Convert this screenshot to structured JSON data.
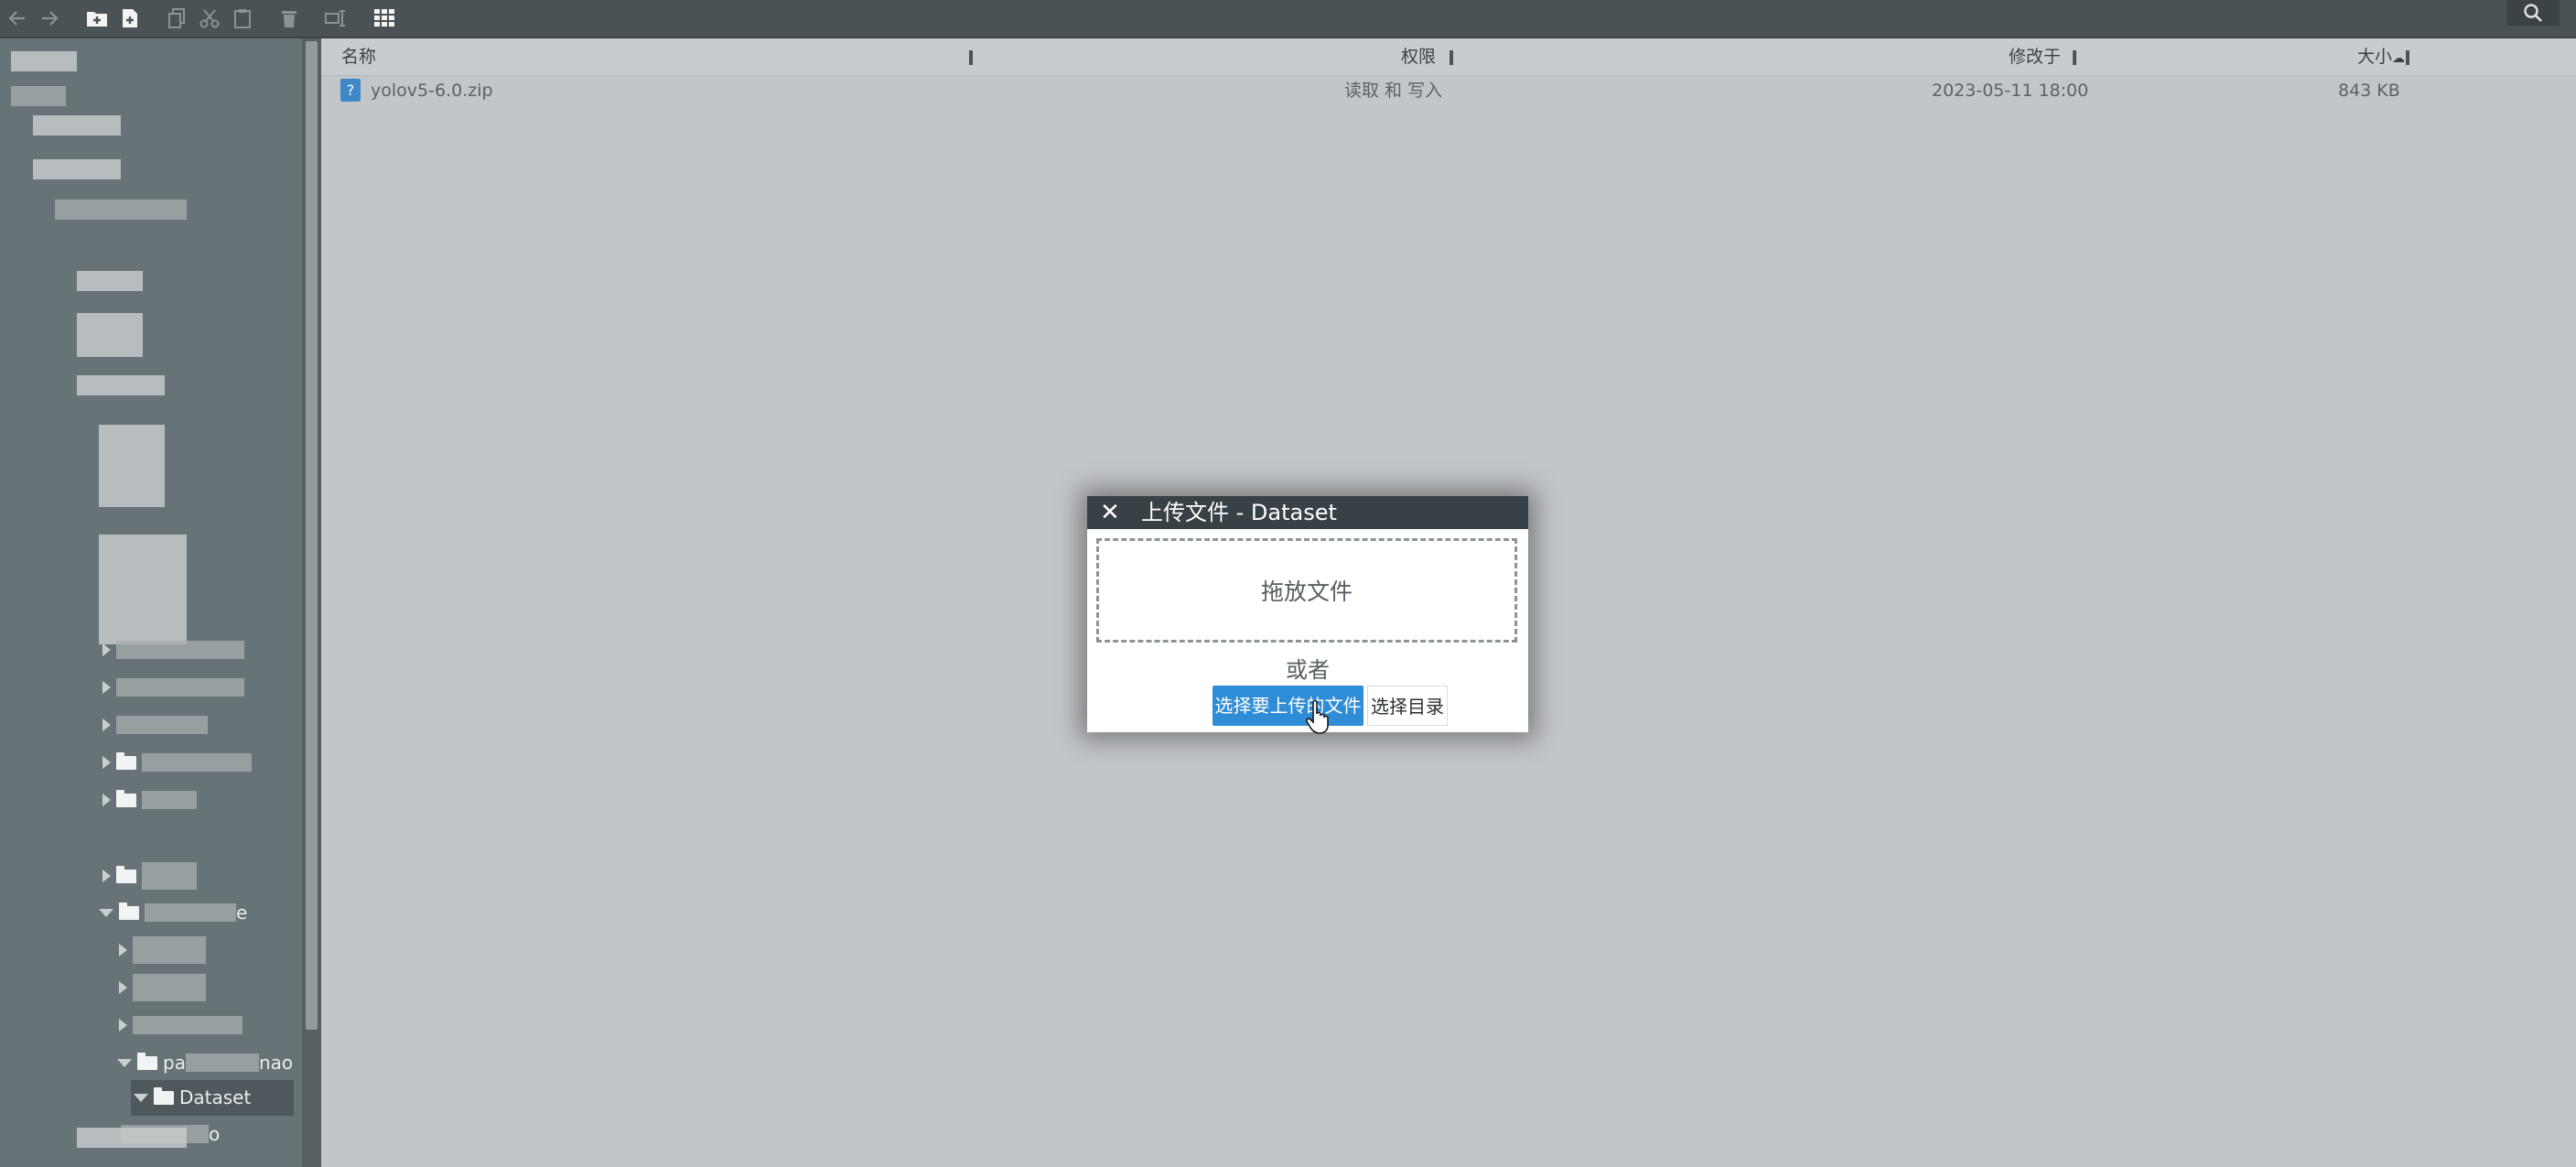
{
  "toolbar": {
    "icons": [
      "arrow-left-icon",
      "arrow-right-icon",
      "new-folder-icon",
      "new-file-icon",
      "copy-icon",
      "cut-icon",
      "paste-icon",
      "delete-icon",
      "rename-icon",
      "grid-view-icon",
      "search-icon"
    ]
  },
  "sidebar": {
    "nodes": [
      {
        "label": "e",
        "expanded": true
      },
      {
        "label": "pa",
        "label_suffix": "nao",
        "expanded": true
      },
      {
        "label": "Dataset",
        "expanded": true,
        "selected": true
      },
      {
        "label": "o"
      }
    ]
  },
  "file_list": {
    "columns": [
      {
        "label": "名称"
      },
      {
        "label": "权限"
      },
      {
        "label": "修改于"
      },
      {
        "label": "大小"
      }
    ],
    "sort_indicator": "☁",
    "rows": [
      {
        "icon": "?",
        "name": "yolov5-6.0.zip",
        "permissions": "读取 和 写入",
        "modified": "2023-05-11 18:00",
        "size": "843 KB"
      }
    ]
  },
  "dialog": {
    "close": "✕",
    "title": "上传文件 - Dataset",
    "dropzone": "拖放文件",
    "or": "或者",
    "choose_files": "选择要上传的文件",
    "choose_dir": "选择目录"
  },
  "colors": {
    "toolbar": "#4a5256",
    "sidebar": "#687377",
    "content": "#c3c6c9",
    "primary_button": "#2f8cd6",
    "dialog_title": "#384146"
  }
}
